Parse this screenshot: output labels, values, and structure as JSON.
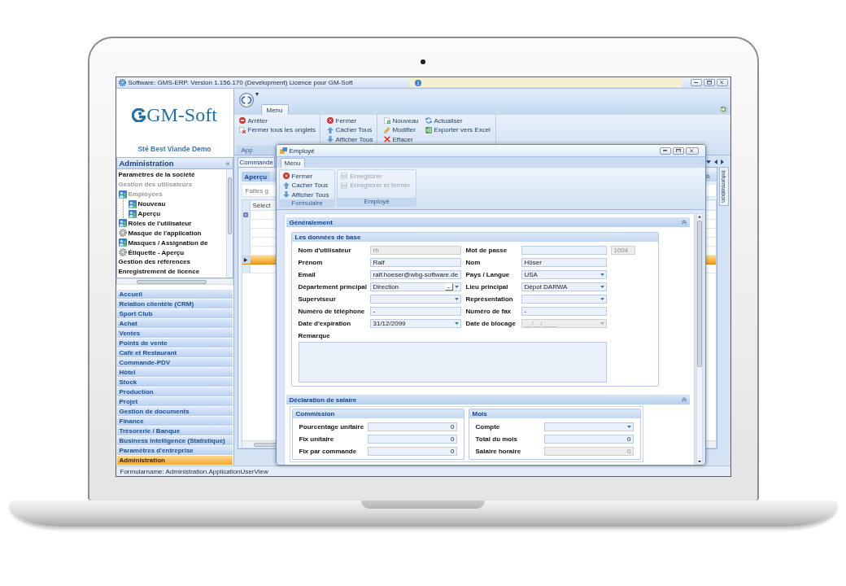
{
  "window": {
    "title": "Software: GMS-ERP. Version 1.156.170 (Development) Licence pour GM-Soft"
  },
  "brand": {
    "logo": "GM-Soft",
    "company": "Sté Best Viande Demo"
  },
  "sidebar": {
    "title": "Administration",
    "collapse": "«",
    "tree": [
      {
        "label": "Paramètres de la société",
        "kind": "category",
        "disabled": false
      },
      {
        "label": "Gestion des utilisateurs",
        "kind": "category",
        "disabled": true
      },
      {
        "label": "Employées",
        "kind": "user-form",
        "disabled": true,
        "children": [
          {
            "label": "Nouveau",
            "kind": "user-form",
            "disabled": false
          },
          {
            "label": "Aperçu",
            "kind": "user-form",
            "disabled": false
          }
        ]
      },
      {
        "label": "Rôles de l'utilisateur",
        "kind": "user-form",
        "disabled": false
      },
      {
        "label": "Masque de l'application",
        "kind": "settings-form",
        "disabled": false
      },
      {
        "label": "Masques / Assignation de",
        "kind": "user-form",
        "disabled": false
      },
      {
        "label": "Étiquette - Aperçu",
        "kind": "settings-form",
        "disabled": false
      },
      {
        "label": "Gestion des références",
        "kind": "category",
        "disabled": false
      },
      {
        "label": "Enregistrement de licence",
        "kind": "category",
        "disabled": false
      }
    ],
    "modules": [
      {
        "label": "Accueil",
        "selected": false
      },
      {
        "label": "Relation clientèle (CRM)",
        "selected": false
      },
      {
        "label": "Sport Club",
        "selected": false
      },
      {
        "label": "Achat",
        "selected": false
      },
      {
        "label": "Ventes",
        "selected": false
      },
      {
        "label": "Points de vente",
        "selected": false
      },
      {
        "label": "Café et Restaurant",
        "selected": false
      },
      {
        "label": "Commande-PDV",
        "selected": false
      },
      {
        "label": "Hôtel",
        "selected": false
      },
      {
        "label": "Stock",
        "selected": false
      },
      {
        "label": "Production",
        "selected": false
      },
      {
        "label": "Projet",
        "selected": false
      },
      {
        "label": "Gestion de documents",
        "selected": false
      },
      {
        "label": "Finance",
        "selected": false
      },
      {
        "label": "Trésorerie / Banque",
        "selected": false
      },
      {
        "label": "Business intelligence (Statistique)",
        "selected": false
      },
      {
        "label": "Paramètres d'entreprise",
        "selected": false
      },
      {
        "label": "Administration",
        "selected": true
      }
    ]
  },
  "ribbon": {
    "quick_access": "▾",
    "tab": "Menu",
    "groups": [
      {
        "label": "App",
        "columns": [
          [
            {
              "label": "Arrêter",
              "kind": "stop"
            },
            {
              "label": "Fermer tous les onglets",
              "kind": "close-all"
            }
          ]
        ]
      },
      {
        "columns": [
          [
            {
              "label": "Fermer",
              "kind": "close"
            },
            {
              "label": "Cacher Tous",
              "kind": "hide"
            },
            {
              "label": "Afficher Tous",
              "kind": "show"
            }
          ]
        ]
      },
      {
        "columns": [
          [
            {
              "label": "Nouveau",
              "kind": "new"
            },
            {
              "label": "Modifier",
              "kind": "edit"
            },
            {
              "label": "Effacer",
              "kind": "delete"
            }
          ],
          [
            {
              "label": "Actualiser",
              "kind": "refresh"
            },
            {
              "label": "Exporter vers Excel",
              "kind": "export"
            }
          ]
        ]
      }
    ]
  },
  "document": {
    "tab": "Commande",
    "view_tab": "Aperçu",
    "group_hint": "Faites g",
    "column": "Sélect",
    "rows": [
      {
        "selected": false
      },
      {
        "selected": false
      },
      {
        "selected": false
      },
      {
        "selected": false
      },
      {
        "selected": true
      },
      {
        "selected": false
      }
    ],
    "side_tab": "Information"
  },
  "dialog": {
    "title": "Employé",
    "tab": "Menu",
    "groups": [
      {
        "label": "Formulaire",
        "items": [
          {
            "label": "Fermer",
            "kind": "close",
            "disabled": false
          },
          {
            "label": "Cacher Tous",
            "kind": "hide",
            "disabled": false
          },
          {
            "label": "Afficher Tous",
            "kind": "show",
            "disabled": false
          }
        ]
      },
      {
        "label": "Employé",
        "items": [
          {
            "label": "Enregistrer",
            "kind": "save",
            "disabled": true
          },
          {
            "label": "Enregistrer et fermer",
            "kind": "save-close",
            "disabled": true
          }
        ]
      }
    ],
    "sections": [
      {
        "title": "Généralement",
        "expanded": true,
        "groups": [
          {
            "title": "Les données de base",
            "rows": [
              [
                {
                  "label": "Nom d'utilisateur",
                  "kind": "text",
                  "value": "rh",
                  "disabled": true
                },
                {
                  "label": "Mot de passe",
                  "kind": "text",
                  "disabled": false,
                  "counter": "1004"
                }
              ],
              [
                {
                  "label": "Prénom",
                  "kind": "text",
                  "value": "Ralf",
                  "disabled": false
                },
                {
                  "label": "Nom",
                  "kind": "text",
                  "value": "Höser",
                  "disabled": false
                }
              ],
              [
                {
                  "label": "Email",
                  "kind": "text",
                  "value": "ralf.hoeser@wbg-software.de",
                  "disabled": false
                },
                {
                  "label": "Pays / Langue",
                  "kind": "dropdown",
                  "value": "USA",
                  "disabled": false
                }
              ],
              [
                {
                  "label": "Département principal",
                  "kind": "lookup",
                  "value": "Direction",
                  "button": "-",
                  "disabled": false
                },
                {
                  "label": "Lieu principal",
                  "kind": "dropdown",
                  "value": "Dépot DARWA",
                  "disabled": false
                }
              ],
              [
                {
                  "label": "Superviseur",
                  "kind": "dropdown",
                  "disabled": false
                },
                {
                  "label": "Représentation",
                  "kind": "dropdown",
                  "disabled": false
                }
              ],
              [
                {
                  "label": "Numéro de téléphone",
                  "kind": "text",
                  "value": "-",
                  "disabled": false
                },
                {
                  "label": "Numéro de fax",
                  "kind": "text",
                  "value": "-",
                  "disabled": false
                }
              ],
              [
                {
                  "label": "Date d'expiration",
                  "kind": "dropdown",
                  "value": "31/12/2099",
                  "disabled": false
                },
                {
                  "label": "Date de blocage",
                  "kind": "dropdown",
                  "placeholder": "__/__/____",
                  "disabled": true
                }
              ],
              [
                {
                  "label": "Remarque",
                  "kind": "textarea",
                  "disabled": false
                }
              ]
            ]
          }
        ]
      },
      {
        "title": "Déclaration de salaire",
        "expanded": true,
        "groups": [
          {
            "title": "Commission",
            "rows": [
              [
                {
                  "label": "Pourcentage unitaire",
                  "kind": "number",
                  "value": "0",
                  "disabled": false
                }
              ],
              [
                {
                  "label": "Fix unitaire",
                  "kind": "number",
                  "value": "0",
                  "disabled": false
                }
              ],
              [
                {
                  "label": "Fix par commande",
                  "kind": "number",
                  "value": "0",
                  "disabled": false
                }
              ]
            ]
          },
          {
            "title": "Mois",
            "rows": [
              [
                {
                  "label": "Compte",
                  "kind": "dropdown",
                  "disabled": false
                }
              ],
              [
                {
                  "label": "Total du mois",
                  "kind": "number",
                  "value": "0",
                  "disabled": false
                }
              ],
              [
                {
                  "label": "Salaire horaire",
                  "kind": "number",
                  "value": "0",
                  "disabled": true
                }
              ]
            ]
          }
        ]
      }
    ]
  },
  "status_bar": {
    "text": "Formularname: Administration.ApplicationUserView"
  }
}
